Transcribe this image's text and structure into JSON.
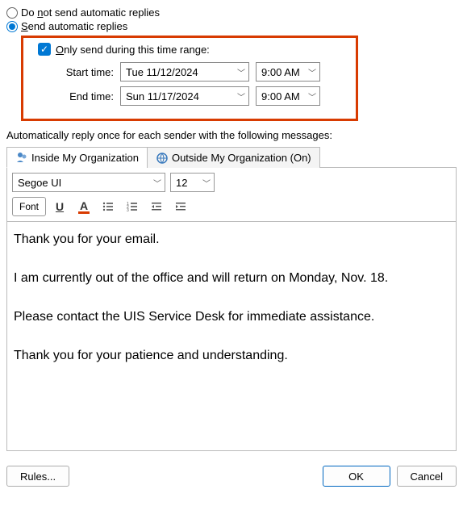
{
  "radios": {
    "do_not_send_pre": "Do ",
    "do_not_send_u": "n",
    "do_not_send_post": "ot send automatic replies",
    "send_pre": "",
    "send_u": "S",
    "send_post": "end automatic replies"
  },
  "time_range": {
    "checkbox_pre": "",
    "checkbox_u": "O",
    "checkbox_post": "nly send during this time range:",
    "start_label": "Start time:",
    "end_label": "End time:",
    "start_date": "Tue 11/12/2024",
    "start_time": "9:00 AM",
    "end_date": "Sun 11/17/2024",
    "end_time": "9:00 AM"
  },
  "section_text": "Automatically reply once for each sender with the following messages:",
  "tabs": {
    "inside": "Inside My Organization",
    "outside": "Outside My Organization (On)"
  },
  "editor": {
    "font_name": "Segoe UI",
    "font_size": "12",
    "font_btn": "Font",
    "body": "Thank you for your email.\n\nI am currently out of the office and will return on Monday, Nov. 18.\n\nPlease contact the UIS Service Desk for immediate assistance.\n\nThank you for your patience and understanding."
  },
  "footer": {
    "rules": "Rules...",
    "ok": "OK",
    "cancel": "Cancel"
  }
}
